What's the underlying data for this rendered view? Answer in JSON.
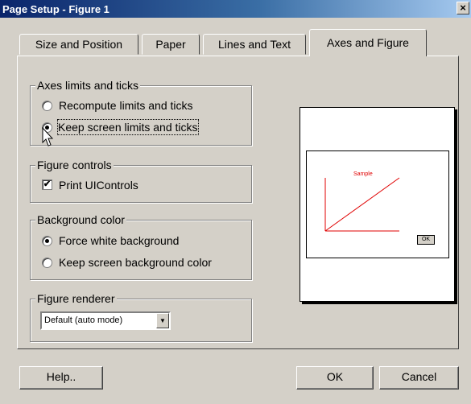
{
  "window": {
    "title": "Page Setup - Figure 1",
    "close_glyph": "×"
  },
  "tabs": [
    {
      "label": "Size and Position",
      "active": false
    },
    {
      "label": "Paper",
      "active": false
    },
    {
      "label": "Lines and Text",
      "active": false
    },
    {
      "label": "Axes and Figure",
      "active": true
    }
  ],
  "axes_limits": {
    "label": "Axes limits and ticks",
    "options": [
      {
        "label": "Recompute limits and ticks",
        "selected": false
      },
      {
        "label": "Keep screen limits and ticks",
        "selected": true
      }
    ]
  },
  "figure_controls": {
    "label": "Figure controls",
    "print_uicontrols": {
      "label": "Print UIControls",
      "checked": true,
      "check_glyph": "✔"
    }
  },
  "background_color": {
    "label": "Background color",
    "options": [
      {
        "label": "Force white background",
        "selected": true
      },
      {
        "label": "Keep screen background color",
        "selected": false
      }
    ]
  },
  "figure_renderer": {
    "label": "Figure renderer",
    "value": "Default (auto mode)",
    "arrow_glyph": "▼"
  },
  "preview": {
    "sample_title": "Sample",
    "ok_label": "OK",
    "line_color": "#e00000"
  },
  "buttons": {
    "help": "Help..",
    "ok": "OK",
    "cancel": "Cancel"
  },
  "icons": {
    "cursor": "mouse-pointer-icon"
  }
}
